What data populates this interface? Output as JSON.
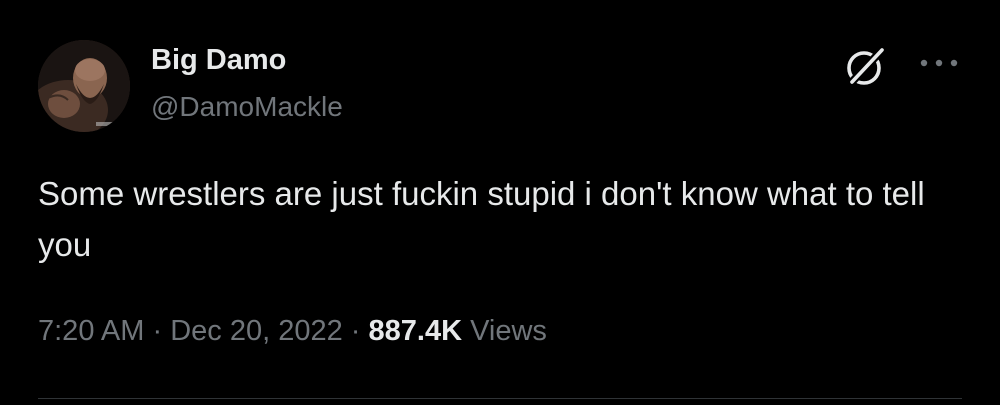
{
  "author": {
    "display_name": "Big Damo",
    "handle": "@DamoMackle"
  },
  "tweet": {
    "text": "Some wrestlers are just fuckin stupid i don't know what to tell you",
    "time": "7:20 AM",
    "separator": "·",
    "date": "Dec 20, 2022",
    "views_count": "887.4K",
    "views_label": "Views"
  },
  "icons": {
    "grok": "grok-icon",
    "more": "more-icon"
  },
  "colors": {
    "background": "#000000",
    "primary_text": "#e7e9ea",
    "secondary_text": "#71767b",
    "divider": "#2f3336"
  }
}
